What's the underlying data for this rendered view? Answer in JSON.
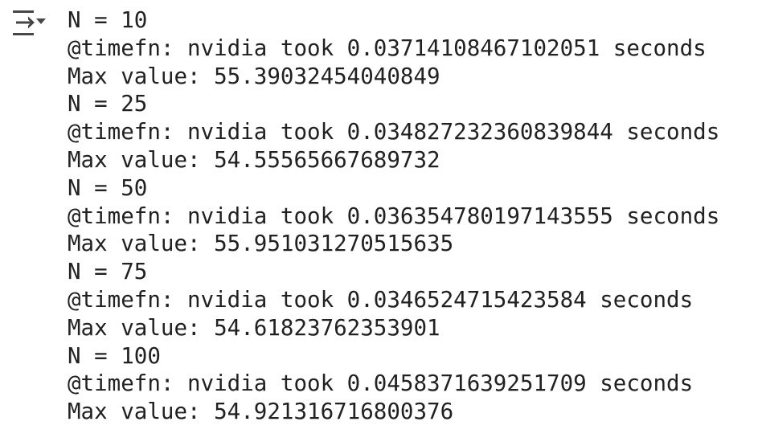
{
  "toolbar": {
    "toggle_icon": "output-collapse-icon"
  },
  "output": {
    "lines": [
      "N = 10",
      "@timefn: nvidia took 0.03714108467102051 seconds",
      "Max value: 55.39032454040849",
      "N = 25",
      "@timefn: nvidia took 0.034827232360839844 seconds",
      "Max value: 54.55565667689732",
      "N = 50",
      "@timefn: nvidia took 0.036354780197143555 seconds",
      "Max value: 55.951031270515635",
      "N = 75",
      "@timefn: nvidia took 0.0346524715423584 seconds",
      "Max value: 54.61823762353901",
      "N = 100",
      "@timefn: nvidia took 0.0458371639251709 seconds",
      "Max value: 54.921316716800376"
    ]
  },
  "colors": {
    "text": "#212121",
    "icon": "#444746",
    "background": "#ffffff"
  }
}
